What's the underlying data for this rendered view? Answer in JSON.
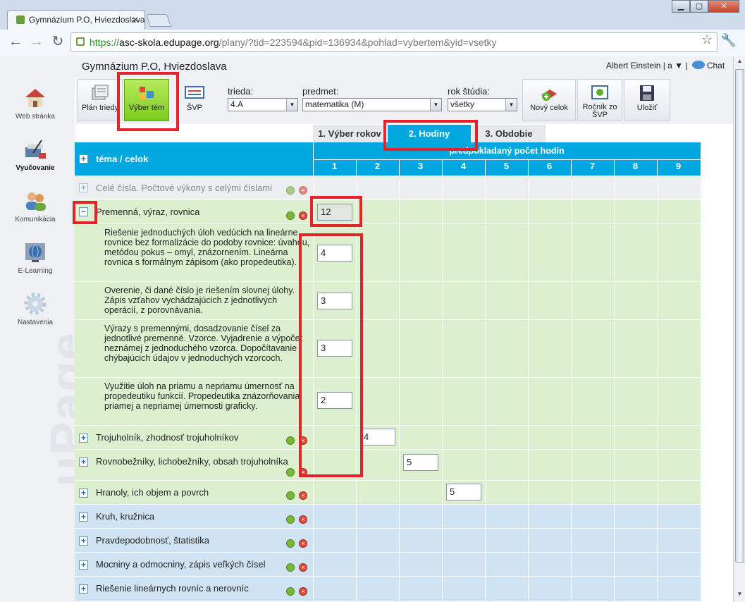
{
  "browser": {
    "tab_title": "Gymnázium P.O, Hviezdoslava",
    "url_scheme": "https://",
    "url_host": "asc-skola.edupage.org",
    "url_path": "/plany/?tid=223594&pid=136934&pohlad=vybertem&yid=vsetky"
  },
  "header": {
    "school_name": "Gymnázium P.O, Hviezdoslava",
    "user": "Albert Einstein | a ▼ |",
    "chat": "Chat"
  },
  "leftnav": [
    {
      "label": "Web stránka",
      "icon": "house-icon"
    },
    {
      "label": "Vyučovanie",
      "icon": "teaching-icon"
    },
    {
      "label": "Komunikácia",
      "icon": "people-icon"
    },
    {
      "label": "E-Learning",
      "icon": "globe-icon"
    },
    {
      "label": "Nastavenia",
      "icon": "gear-icon"
    }
  ],
  "watermark": "uPage",
  "ribbon": {
    "plan_triedy": "Plán triedy",
    "vyber_tem": "Výber tém",
    "svp": "ŠVP",
    "trieda_label": "trieda:",
    "trieda_value": "4.A",
    "predmet_label": "predmet:",
    "predmet_value": "matematika (M)",
    "rok_label": "rok štúdia:",
    "rok_value": "všetky",
    "novy_celok": "Nový celok",
    "rocnik_zo_svp": "Ročník zo ŠVP",
    "ulozit": "Uložiť"
  },
  "tabs": [
    "1. Výber rokov",
    "2. Hodiny",
    "3. Obdobie"
  ],
  "table": {
    "col_header": "téma / celok",
    "hours_header": "predpokladaný počet hodín",
    "columns": [
      "1",
      "2",
      "3",
      "4",
      "5",
      "6",
      "7",
      "8",
      "9"
    ],
    "rows": [
      {
        "label": "Celé čísla. Počtové výkony s celými číslami",
        "expander": "+"
      },
      {
        "label": "Premenná, výraz, rovnica",
        "expander": "−",
        "hours": "12"
      },
      {
        "label": "Trojuholník, zhodnosť trojuholníkov",
        "expander": "+",
        "hours": "4"
      },
      {
        "label": "Rovnobežníky, lichobežníky, obsah trojuholníka",
        "expander": "+",
        "hours": "5"
      },
      {
        "label": "Hranoly, ich objem a povrch",
        "expander": "+",
        "hours": "5"
      },
      {
        "label": "Kruh, kružnica",
        "expander": "+"
      },
      {
        "label": "Pravdepodobnosť, štatistika",
        "expander": "+"
      },
      {
        "label": "Mocniny a odmocniny, zápis veľkých čísel",
        "expander": "+"
      },
      {
        "label": "Riešenie lineárnych rovníc a nerovníc",
        "expander": "+"
      }
    ],
    "subtopics": [
      {
        "text": "Riešenie jednoduchých úloh vedúcich na lineárne rovnice bez formalizácie do podoby rovnice: úvahou, metódou pokus – omyl, znázornením. Lineárna rovnica s formálnym zápisom (ako propedeutika).",
        "hours": "4"
      },
      {
        "text": "Overenie, či dané číslo je riešením slovnej úlohy. Zápis vzťahov vychádzajúcich z jednotlivých operácií, z porovnávania.",
        "hours": "3"
      },
      {
        "text": "Výrazy s premennými, dosadzovanie čísel za jednotlivé premenné. Vzorce. Vyjadrenie a výpočet neznámej z jednoduchého vzorca. Dopočítavanie chýbajúcich údajov v jednoduchých vzorcoch.",
        "hours": "3"
      },
      {
        "text": "Využitie úloh na priamu a nepriamu úmernosť na propedeutiku funkcií. Propedeutika znázorňovania priamej a nepriamej úmernosti graficky.",
        "hours": "2"
      }
    ]
  },
  "colors": {
    "accent": "#00a8df",
    "green_row": "#dcf0d0",
    "blue_row": "#cfe3f2",
    "highlight": "#e4222a",
    "active_button": "#7dcc1e"
  }
}
